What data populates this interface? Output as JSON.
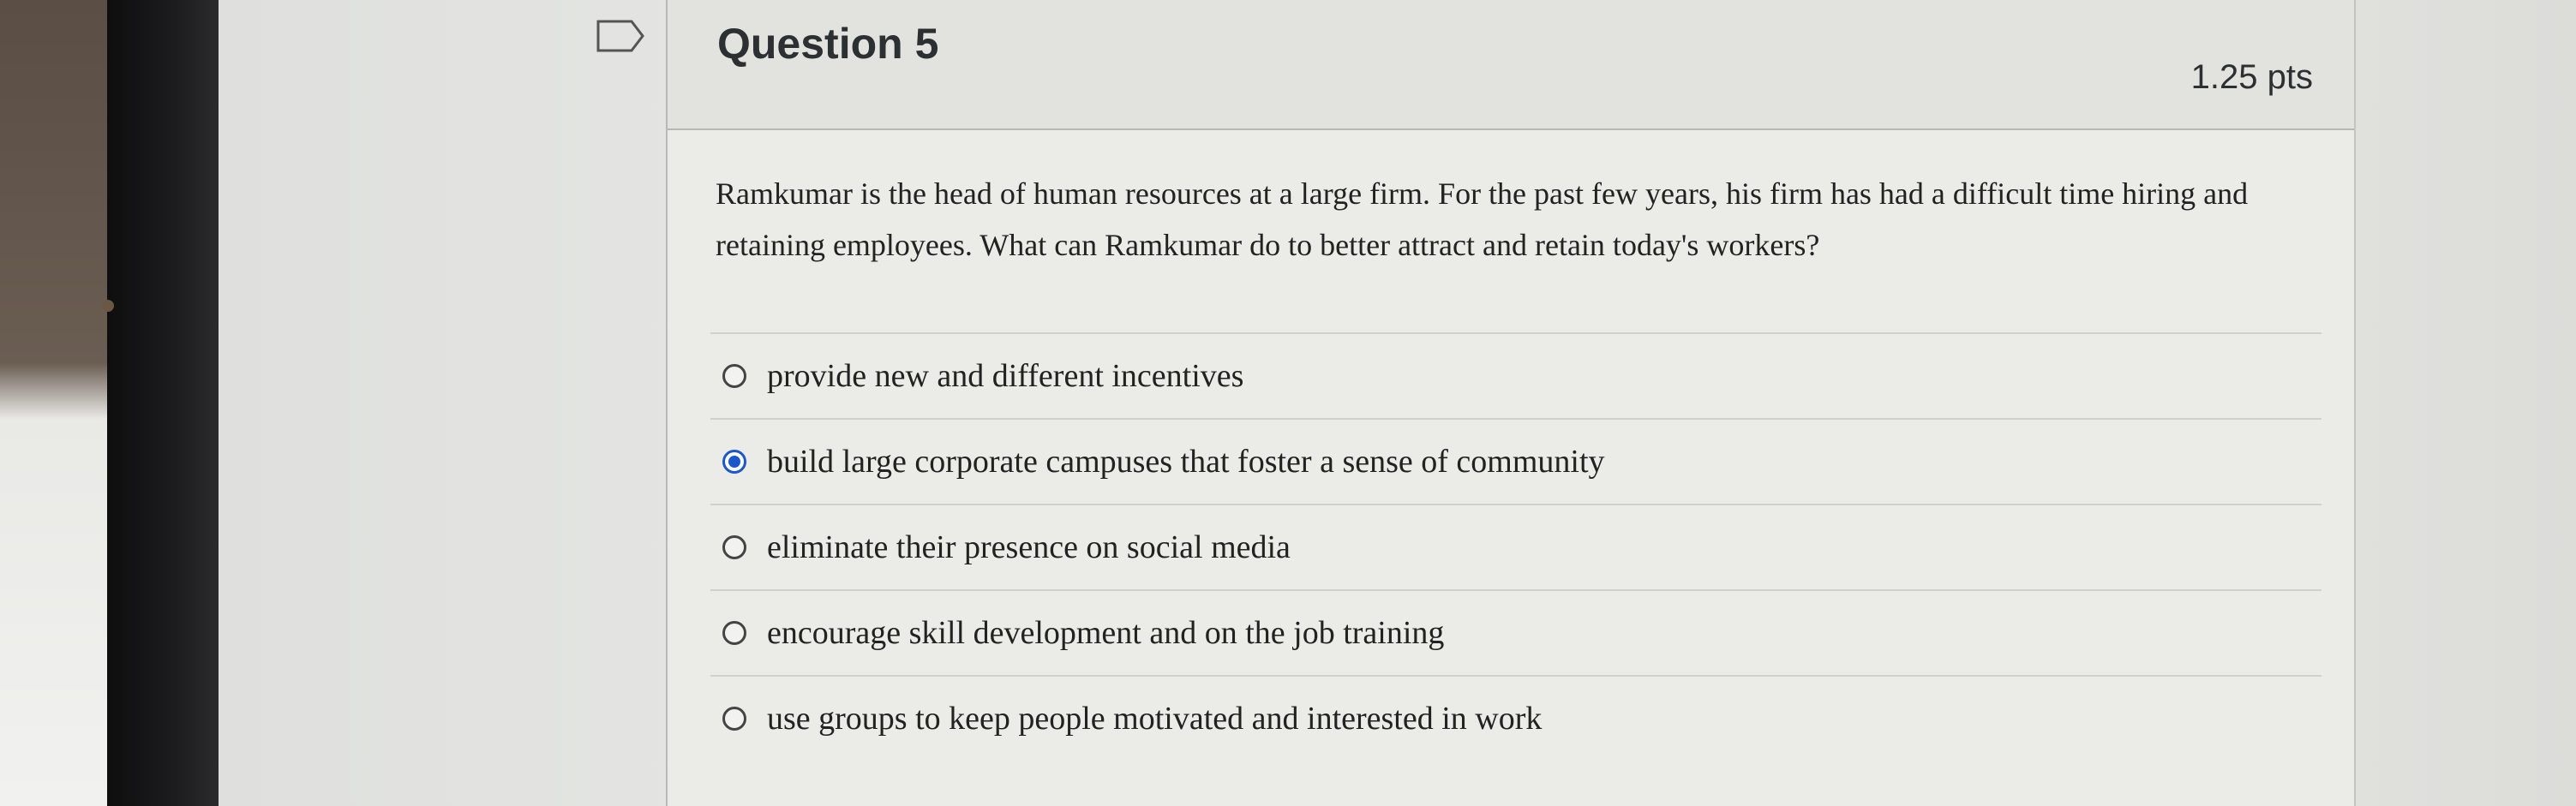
{
  "question": {
    "title": "Question 5",
    "points": "1.25 pts",
    "text": "Ramkumar is the head of human resources at a large firm. For the past few years, his firm has had a difficult time hiring and retaining employees. What can Ramkumar do to better attract and retain today's workers?"
  },
  "answers": [
    {
      "label": "provide new and different incentives",
      "selected": false
    },
    {
      "label": "build large corporate campuses that foster a sense of community",
      "selected": true
    },
    {
      "label": "eliminate their presence on social media",
      "selected": false
    },
    {
      "label": "encourage skill development and on the job training",
      "selected": false
    },
    {
      "label": "use groups to keep people motivated and interested in work",
      "selected": false
    }
  ],
  "colors": {
    "accent": "#1c58c9"
  },
  "icons": {
    "flag": "bookmark-flag-icon"
  }
}
